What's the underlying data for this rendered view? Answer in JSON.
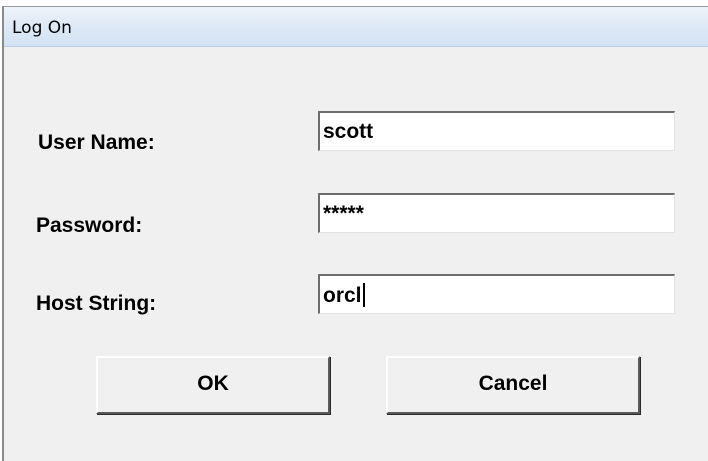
{
  "window": {
    "title": "Log On"
  },
  "form": {
    "username_label": "User Name:",
    "username_value": "scott",
    "password_label": "Password:",
    "password_value": "*****",
    "host_label": "Host String:",
    "host_value": "orcl"
  },
  "buttons": {
    "ok_label": "OK",
    "cancel_label": "Cancel"
  },
  "colors": {
    "dialog_background": "#f0f0f0",
    "titlebar_background": "#dfeaf6",
    "field_background": "#ffffff"
  }
}
